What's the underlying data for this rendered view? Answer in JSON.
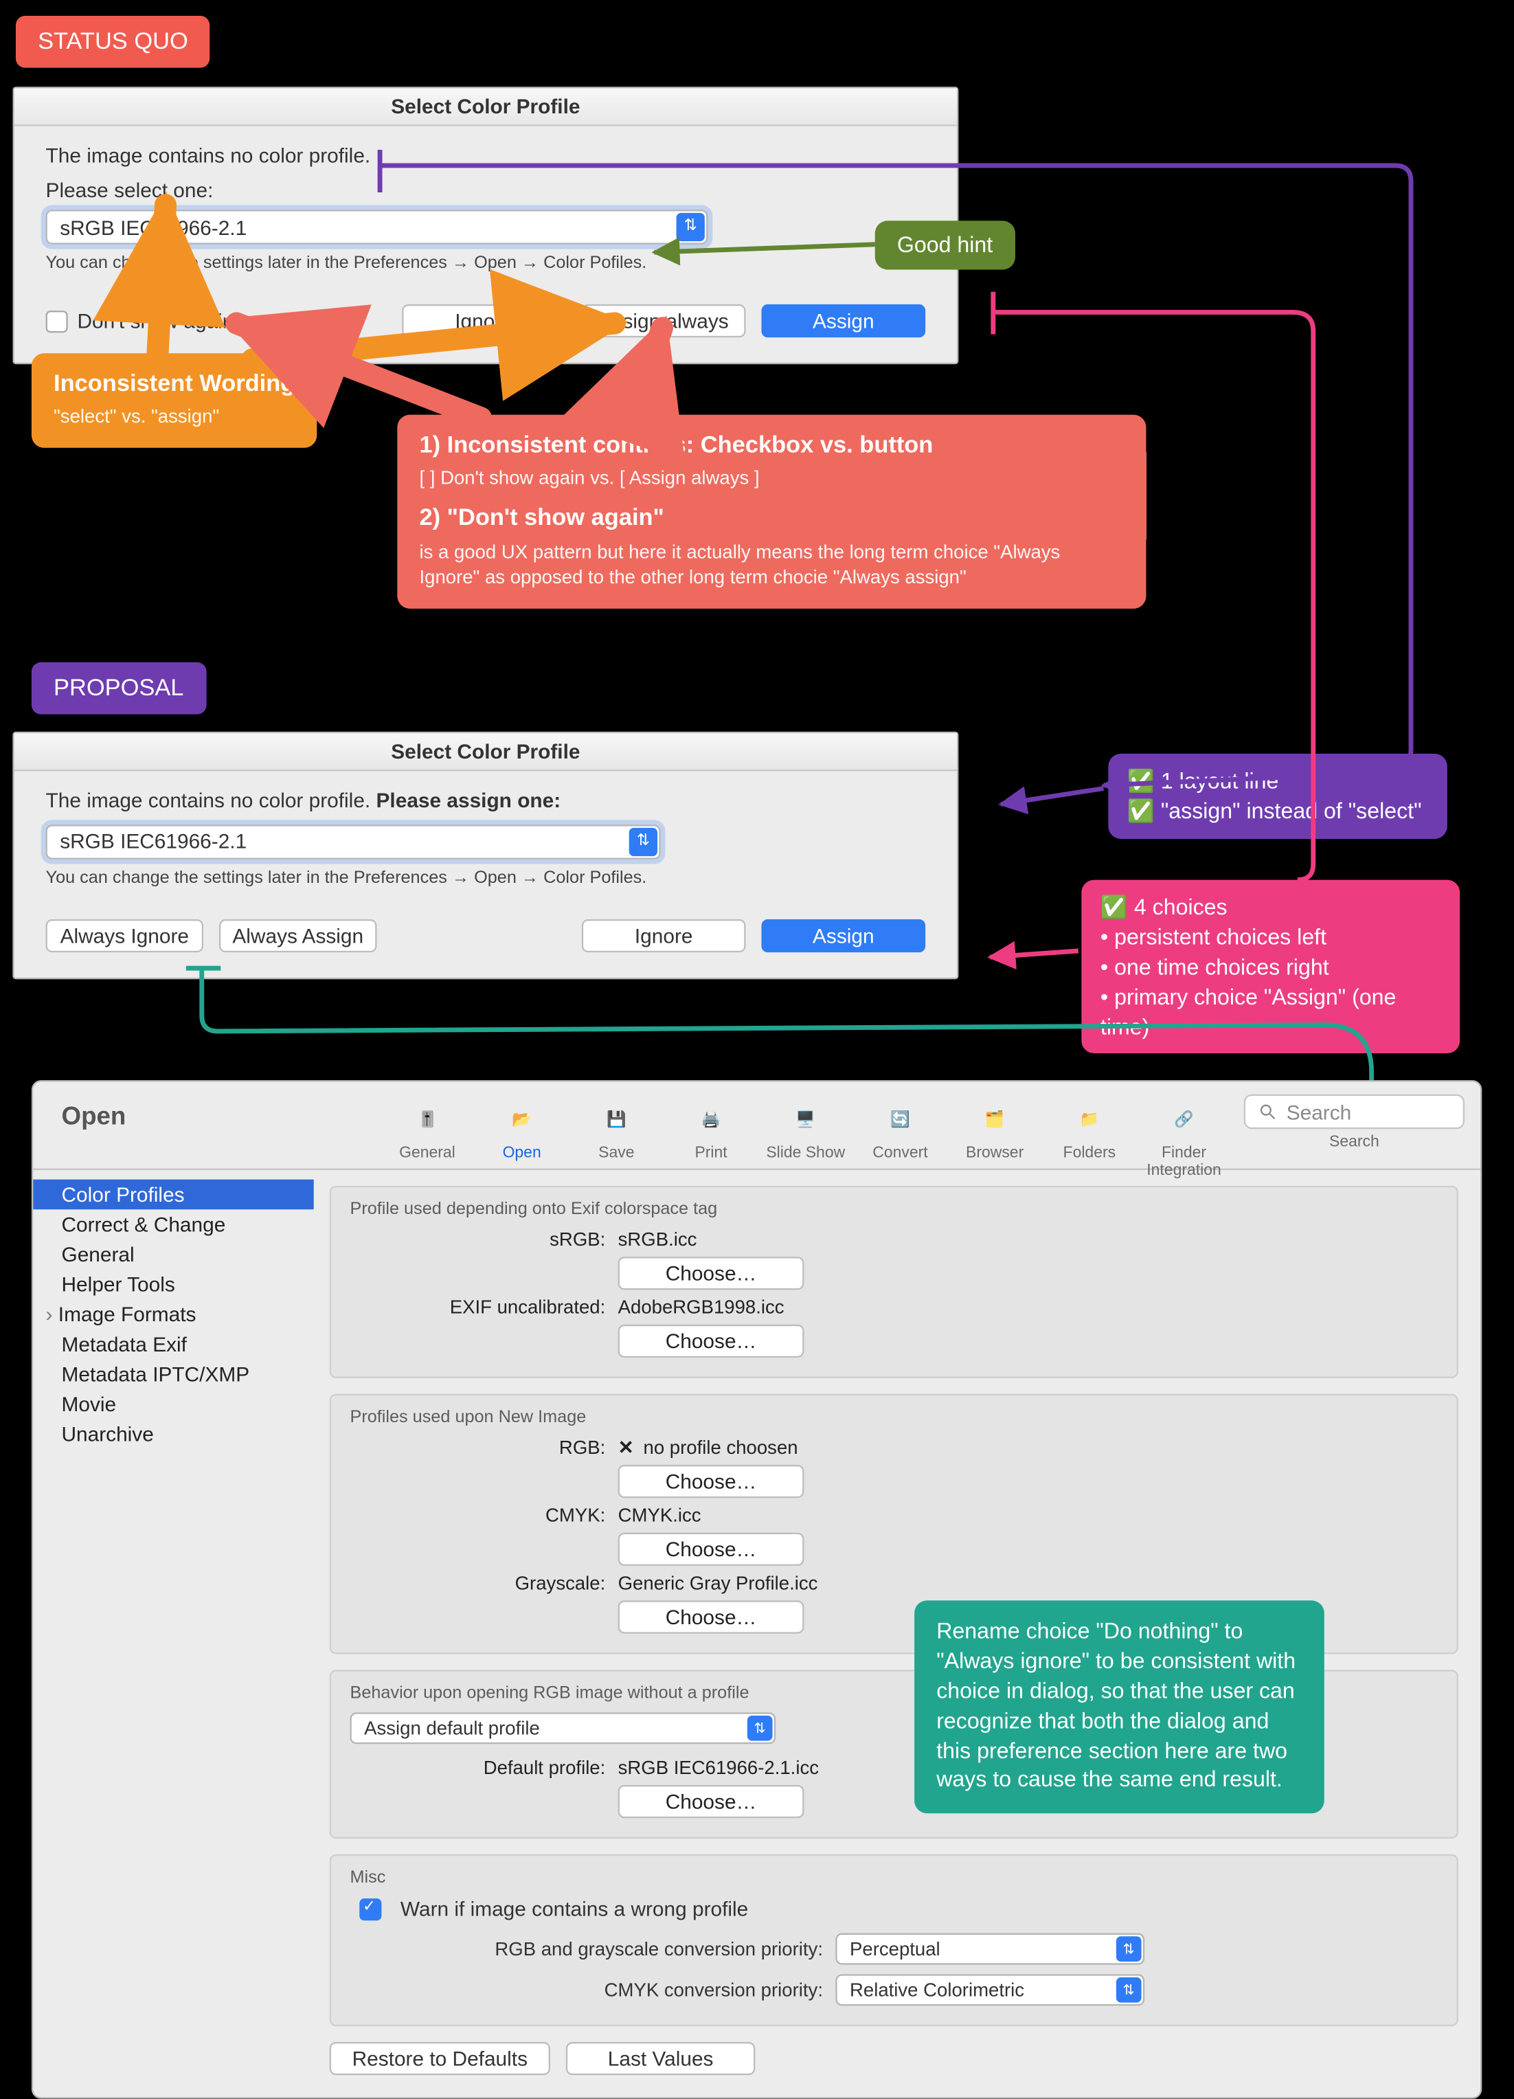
{
  "labels": {
    "status_quo": "STATUS QUO",
    "proposal": "PROPOSAL"
  },
  "dialog_sq": {
    "title": "Select Color Profile",
    "msg1": "The image contains no color profile.",
    "msg2": "Please select one:",
    "select_value": "sRGB IEC61966-2.1",
    "hint": "You can change the settings later in the Preferences → Open → Color Pofiles.",
    "dont_show": "Don't show again",
    "btn_ignore": "Ignore",
    "btn_assign_always": "Assign always",
    "btn_assign": "Assign"
  },
  "dialog_prop": {
    "title": "Select Color Profile",
    "msg1": "The image contains no color profile.",
    "msg2_bold": "Please assign one:",
    "select_value": "sRGB IEC61966-2.1",
    "hint": "You can change the settings later in the Preferences → Open → Color Pofiles.",
    "btn_always_ignore": "Always Ignore",
    "btn_always_assign": "Always Assign",
    "btn_ignore": "Ignore",
    "btn_assign": "Assign"
  },
  "anno": {
    "olive": "Good hint",
    "orange_title": "Inconsistent Wording",
    "orange_sub": "\"select\" vs. \"assign\"",
    "red_1_title": "1) Inconsistent controls: Checkbox vs. button",
    "red_1_sub": "[ ] Don't show again   vs.    [ Assign always ]",
    "red_2_title": "2) \"Don't show again\"",
    "red_2_body": "is a good UX pattern but here it actually means the long term choice \"Always Ignore\"  as opposed to the other long term chocie \"Always assign\"",
    "purple_1": "1 layout line",
    "purple_2": "\"assign\" instead of \"select\"",
    "pink_1": "4 choices",
    "pink_b1": "• persistent choices left",
    "pink_b2": "• one time choices right",
    "pink_b3": "• primary choice \"Assign\" (one time)",
    "teal": "Rename choice \"Do nothing\" to \"Always ignore\" to be consistent with choice in dialog, so that the user can recognize that both the dialog and this preference section here are two ways to cause the same end result."
  },
  "pref": {
    "window_title": "Open",
    "search_placeholder": "Search",
    "search_label": "Search",
    "tools": [
      "General",
      "Open",
      "Save",
      "Print",
      "Slide Show",
      "Convert",
      "Browser",
      "Folders",
      "Finder Integration"
    ],
    "sidebar": [
      "Color Profiles",
      "Correct & Change",
      "General",
      "Helper Tools",
      "Image Formats",
      "Metadata Exif",
      "Metadata IPTC/XMP",
      "Movie",
      "Unarchive"
    ],
    "panel1_head": "Profile used depending onto Exif colorspace tag",
    "srgb_k": "sRGB:",
    "srgb_v": "sRGB.icc",
    "exif_k": "EXIF uncalibrated:",
    "exif_v": "AdobeRGB1998.icc",
    "panel2_head": "Profiles used upon New Image",
    "rgb_k": "RGB:",
    "rgb_v": "no profile choosen",
    "cmyk_k": "CMYK:",
    "cmyk_v": "CMYK.icc",
    "gray_k": "Grayscale:",
    "gray_v": "Generic Gray Profile.icc",
    "panel3_head": "Behavior upon opening RGB image without a profile",
    "behavior_value": "Assign default profile",
    "def_k": "Default profile:",
    "def_v": "sRGB IEC61966-2.1.icc",
    "panel4_head": "Misc",
    "warn": "Warn if image contains a wrong profile",
    "rgb_prio_k": "RGB and grayscale conversion priority:",
    "rgb_prio_v": "Perceptual",
    "cmyk_prio_k": "CMYK conversion priority:",
    "cmyk_prio_v": "Relative Colorimetric",
    "choose": "Choose…",
    "restore": "Restore to Defaults",
    "last": "Last Values"
  }
}
